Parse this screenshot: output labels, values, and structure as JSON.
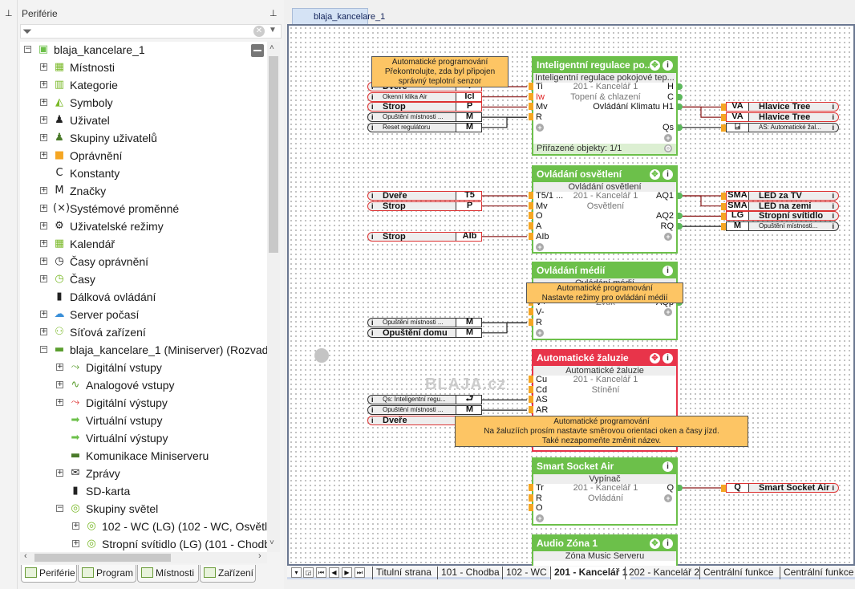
{
  "panel": {
    "title": "Periférie",
    "tree": [
      {
        "level": 0,
        "exp": "minus",
        "icon": "miniserver-icon",
        "glyph": "▣",
        "color": "#6cc04a",
        "label": "blaja_kancelare_1"
      },
      {
        "level": 1,
        "exp": "plus",
        "icon": "rooms-icon",
        "glyph": "▦",
        "color": "#7ab928",
        "label": "Místnosti"
      },
      {
        "level": 1,
        "exp": "plus",
        "icon": "categories-icon",
        "glyph": "▥",
        "color": "#7ab928",
        "label": "Kategorie"
      },
      {
        "level": 1,
        "exp": "plus",
        "icon": "symbols-icon",
        "glyph": "◭",
        "color": "#7ab928",
        "label": "Symboly"
      },
      {
        "level": 1,
        "exp": "plus",
        "icon": "user-icon",
        "glyph": "♟",
        "color": "#222",
        "label": "Uživatel"
      },
      {
        "level": 1,
        "exp": "plus",
        "icon": "user-group-icon",
        "glyph": "♟",
        "color": "#4a7a2a",
        "label": "Skupiny uživatelů"
      },
      {
        "level": 1,
        "exp": "plus",
        "icon": "lock-icon",
        "glyph": "■",
        "color": "#f5a623",
        "label": "Oprávnění"
      },
      {
        "level": 1,
        "exp": "none",
        "icon": "constant-icon",
        "glyph": "C",
        "color": "#222",
        "label": "Konstanty"
      },
      {
        "level": 1,
        "exp": "plus",
        "icon": "marker-icon",
        "glyph": "M",
        "color": "#222",
        "label": "Značky"
      },
      {
        "level": 1,
        "exp": "plus",
        "icon": "variable-icon",
        "glyph": "(×)",
        "color": "#222",
        "label": "Systémové proměnné"
      },
      {
        "level": 1,
        "exp": "plus",
        "icon": "gear-icon",
        "glyph": "⚙",
        "color": "#222",
        "label": "Uživatelské režimy"
      },
      {
        "level": 1,
        "exp": "plus",
        "icon": "calendar-icon",
        "glyph": "▦",
        "color": "#7ab928",
        "label": "Kalendář"
      },
      {
        "level": 1,
        "exp": "plus",
        "icon": "clock-lock-icon",
        "glyph": "◷",
        "color": "#222",
        "label": "Časy oprávnění"
      },
      {
        "level": 1,
        "exp": "plus",
        "icon": "clock-icon",
        "glyph": "◷",
        "color": "#7ab928",
        "label": "Časy"
      },
      {
        "level": 1,
        "exp": "none",
        "icon": "remote-icon",
        "glyph": "▮",
        "color": "#222",
        "label": "Dálková ovládání"
      },
      {
        "level": 1,
        "exp": "plus",
        "icon": "weather-icon",
        "glyph": "☁",
        "color": "#3a8fd8",
        "label": "Server počasí"
      },
      {
        "level": 1,
        "exp": "plus",
        "icon": "network-icon",
        "glyph": "⚇",
        "color": "#7ab928",
        "label": "Síťová zařízení"
      },
      {
        "level": 1,
        "exp": "minus",
        "icon": "miniserver-icon",
        "glyph": "▬",
        "color": "#5a9e2e",
        "label": "blaja_kancelare_1 (Miniserver) (Rozvaděč"
      },
      {
        "level": 2,
        "exp": "plus",
        "icon": "digital-input-icon",
        "glyph": "⤳",
        "color": "#5a9e2e",
        "label": "Digitální vstupy"
      },
      {
        "level": 2,
        "exp": "plus",
        "icon": "analog-input-icon",
        "glyph": "∿",
        "color": "#5a9e2e",
        "label": "Analogové vstupy"
      },
      {
        "level": 2,
        "exp": "plus",
        "icon": "digital-output-icon",
        "glyph": "⤳",
        "color": "#d33",
        "label": "Digitální výstupy"
      },
      {
        "level": 2,
        "exp": "none",
        "icon": "virtual-input-icon",
        "glyph": "➡",
        "color": "#6cc04a",
        "label": "Virtuální vstupy"
      },
      {
        "level": 2,
        "exp": "none",
        "icon": "virtual-output-icon",
        "glyph": "➡",
        "color": "#6cc04a",
        "label": "Virtuální výstupy"
      },
      {
        "level": 2,
        "exp": "none",
        "icon": "communication-icon",
        "glyph": "▬",
        "color": "#4a7a2a",
        "label": "Komunikace Miniserveru"
      },
      {
        "level": 2,
        "exp": "plus",
        "icon": "messages-icon",
        "glyph": "✉",
        "color": "#222",
        "label": "Zprávy"
      },
      {
        "level": 2,
        "exp": "none",
        "icon": "sd-card-icon",
        "glyph": "▮",
        "color": "#222",
        "label": "SD-karta"
      },
      {
        "level": 2,
        "exp": "minus",
        "icon": "light-group-icon",
        "glyph": "◎",
        "color": "#7ab928",
        "label": "Skupiny světel"
      },
      {
        "level": 3,
        "exp": "plus",
        "icon": "light-icon",
        "glyph": "◎",
        "color": "#7ab928",
        "label": "102 - WC (LG) (102 - WC, Osvětle"
      },
      {
        "level": 3,
        "exp": "plus",
        "icon": "light-icon",
        "glyph": "◎",
        "color": "#7ab928",
        "label": "Stropní svítidlo (LG) (101 - Chodb"
      }
    ],
    "bottom_tabs": [
      "Periférie",
      "Program",
      "Místnosti",
      "Zařízení"
    ],
    "active_bottom_tab": 0
  },
  "document_tab": {
    "label": "blaja_kancelare_1",
    "close": "x"
  },
  "colors": {
    "ok_header": "#6cc04a",
    "alarm_header": "#e8344a",
    "wire_digital": "#8b1a1a",
    "wire_other": "#222222",
    "warn_input": "#e02020",
    "tooltip": "#fdc564"
  },
  "watermark": "BLAJA.cz",
  "blocks": [
    {
      "title": "Inteligentní regulace po...",
      "subtitle": "Inteligentní regulace pokojové tep...",
      "state": "ok",
      "icons": [
        "move",
        "info"
      ],
      "inputs": [
        "Ti",
        "Iw",
        "Mv",
        "R",
        "+"
      ],
      "warn_inputs": [
        "Iw"
      ],
      "outputs": [
        "H",
        "C",
        "H1",
        "",
        "Qs",
        "+"
      ],
      "center": [
        "201 - Kancelář 1",
        "Topení & chlazení"
      ],
      "right_note": "Ovládání Klimatu",
      "footer": "Přiřazené objekty: 1/1",
      "left_links": [
        {
          "label": "Dveře",
          "code": "T",
          "type": "digital",
          "pin": "Ti"
        },
        {
          "label": "Okenní klika Air",
          "code": "Icl",
          "type": "digital",
          "pin": "Iw"
        },
        {
          "label": "Strop",
          "code": "P",
          "type": "digital",
          "pin": "Mv"
        },
        {
          "label": "Opuštění místnosti ...",
          "code": "M",
          "type": "other",
          "pin": "R"
        },
        {
          "label": "Reset regulátoru",
          "code": "M",
          "type": "other",
          "pin": "R"
        }
      ],
      "right_links": [
        {
          "code": "VA",
          "label": "Hlavice Tree",
          "type": "digital",
          "pin": "H1"
        },
        {
          "code": "VA",
          "label": "Hlavice Tree",
          "type": "digital",
          "pin": "H1"
        },
        {
          "code": "⍈",
          "label": "AS: Automatické žal...",
          "type": "other",
          "pin": "Qs"
        }
      ]
    },
    {
      "title": "Ovládání osvětlení",
      "subtitle": "Ovládání osvětlení",
      "state": "ok",
      "icons": [
        "move",
        "info"
      ],
      "inputs": [
        "T5/1 ...",
        "Mv",
        "O",
        "A",
        "AIb",
        "+"
      ],
      "outputs": [
        "AQ1",
        "",
        "AQ2",
        "RQ",
        "+"
      ],
      "center": [
        "201 - Kancelář 1",
        "Osvětlení"
      ],
      "left_links": [
        {
          "label": "Dveře",
          "code": "T5",
          "type": "digital",
          "pin": "T5/1 ..."
        },
        {
          "label": "Strop",
          "code": "P",
          "type": "digital",
          "pin": "Mv"
        },
        {
          "label": "Strop",
          "code": "AIb",
          "type": "digital",
          "pin": "AIb"
        }
      ],
      "right_links": [
        {
          "code": "SMA",
          "label": "LED za TV",
          "type": "digital",
          "pin": "AQ1"
        },
        {
          "code": "SMA",
          "label": "LED na zemi",
          "type": "digital",
          "pin": "AQ1"
        },
        {
          "code": "LG",
          "label": "Stropní svítidlo",
          "type": "digital",
          "pin": "AQ2"
        },
        {
          "code": "M",
          "label": "Opuštění místnosti...",
          "type": "other",
          "pin": "RQ"
        }
      ]
    },
    {
      "title": "Ovládání médií",
      "subtitle": "Ovládání médií",
      "state": "ok",
      "icons": [
        "info"
      ],
      "inputs": [
        "",
        "V+",
        "V-",
        "R",
        "+"
      ],
      "outputs": [
        "",
        "AQp",
        "+"
      ],
      "center": [
        "",
        "Zvuk"
      ],
      "left_links": [
        {
          "label": "Opuštění místnosti ...",
          "code": "M",
          "type": "other",
          "pin": "R"
        },
        {
          "label": "Opuštění domu",
          "code": "M",
          "type": "other",
          "pin": "R"
        }
      ],
      "right_links": []
    },
    {
      "title": "Automatické žaluzie",
      "subtitle": "Automatické žaluzie",
      "state": "alarm",
      "icons": [
        "move",
        "info"
      ],
      "inputs": [
        "Cu",
        "Cd",
        "AS",
        "AR"
      ],
      "outputs": [],
      "center": [
        "201 - Kancelář 1",
        "Stínění"
      ],
      "left_links": [
        {
          "label": "Qs: Inteligentní regu...",
          "code": "⮐",
          "type": "other",
          "pin": "AS"
        },
        {
          "label": "Opuštění místnosti ...",
          "code": "M",
          "type": "other",
          "pin": "AR"
        },
        {
          "label": "Dveře",
          "code": "",
          "type": "digital",
          "pin": ""
        }
      ],
      "right_links": []
    },
    {
      "title": "Smart Socket Air",
      "subtitle": "Vypínač",
      "state": "ok",
      "icons": [
        "info"
      ],
      "inputs": [
        "Tr",
        "R",
        "O",
        "+"
      ],
      "outputs": [
        "Q",
        "+"
      ],
      "center": [
        "201 - Kancelář 1",
        "Ovládání"
      ],
      "left_links": [],
      "right_links": [
        {
          "code": "Q",
          "label": "Smart Socket Air",
          "type": "digital",
          "pin": "Q"
        }
      ]
    },
    {
      "title": "Audio Zóna 1",
      "subtitle": "Zóna Music Serveru",
      "state": "ok",
      "icons": [
        "move",
        "info"
      ],
      "inputs": [],
      "outputs": [],
      "center": [],
      "left_links": [],
      "right_links": []
    }
  ],
  "tooltips": [
    {
      "lines": [
        "Automatické programování",
        "Překontrolujte, zda byl připojen",
        "správný teplotní senzor"
      ]
    },
    {
      "lines": [
        "Automatické programování",
        "Nastavte režimy pro ovládání médií"
      ]
    },
    {
      "lines": [
        "Automatické programování",
        "Na žaluzíích prosím nastavte směrovou orientaci oken a časy jízd.",
        "Také nezapomeňte změnit název."
      ]
    }
  ],
  "page_tabs": [
    "Titulní strana",
    "101 - Chodba",
    "102 - WC",
    "201 - Kancelář 1",
    "202 - Kancelář 2",
    "Centrální funkce",
    "Centrální funkce"
  ],
  "active_page_tab": 3,
  "nav_buttons": [
    {
      "icon": "dropdown-icon",
      "glyph": "▾"
    },
    {
      "icon": "page-icon",
      "glyph": "◲"
    },
    {
      "icon": "first-page-icon",
      "glyph": "⏮"
    },
    {
      "icon": "prev-page-icon",
      "glyph": "◀"
    },
    {
      "icon": "next-page-icon",
      "glyph": "▶"
    },
    {
      "icon": "last-page-icon",
      "glyph": "⏭"
    }
  ]
}
